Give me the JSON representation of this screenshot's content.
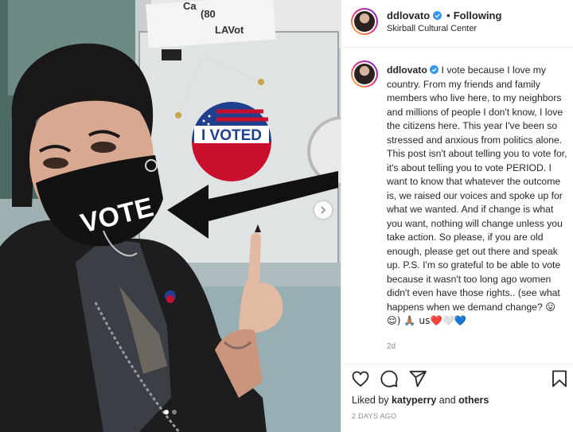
{
  "header": {
    "username": "ddlovato",
    "separator": "•",
    "follow_status": "Following",
    "location": "Skirball Cultural Center"
  },
  "photo": {
    "sticker_top": "I VOTED",
    "mask_text": "VOTE",
    "sign_lines": [
      "Ca",
      "(80",
      "LAVot"
    ]
  },
  "caption": {
    "username": "ddlovato",
    "text": " I vote because I love my country. From my friends and family members who live here, to my neighbors and millions of people I don't know, I love the citizens here. This year I've been so stressed and anxious from politics alone. This post isn't about telling you to vote for, it's about telling you to vote PERIOD. I want to know that whatever the outcome is, we raised our voices and spoke up for what we wanted. And if change is what you want, nothing will change unless you take action. So please, if you are old enough, please get out there and speak up. P.S. I'm so grateful to be able to vote because it wasn't too long ago women didn't even have those rights.. (see what happens when we demand change? ",
    "emoji_tail": "😛😌) 🙏🏽 us❤️🤍💙",
    "time_ago": "2d"
  },
  "engagement": {
    "liked_prefix": "Liked by ",
    "liked_user": "katyperry",
    "liked_mid": " and ",
    "liked_others": "others",
    "date": "2 DAYS AGO"
  },
  "colors": {
    "verified": "#3897f0",
    "text": "#262626",
    "muted": "#8e8e8e",
    "border": "#efefef"
  },
  "icons": [
    "verified-badge-icon",
    "heart-icon",
    "comment-icon",
    "share-icon",
    "save-icon",
    "chevron-right-icon"
  ]
}
